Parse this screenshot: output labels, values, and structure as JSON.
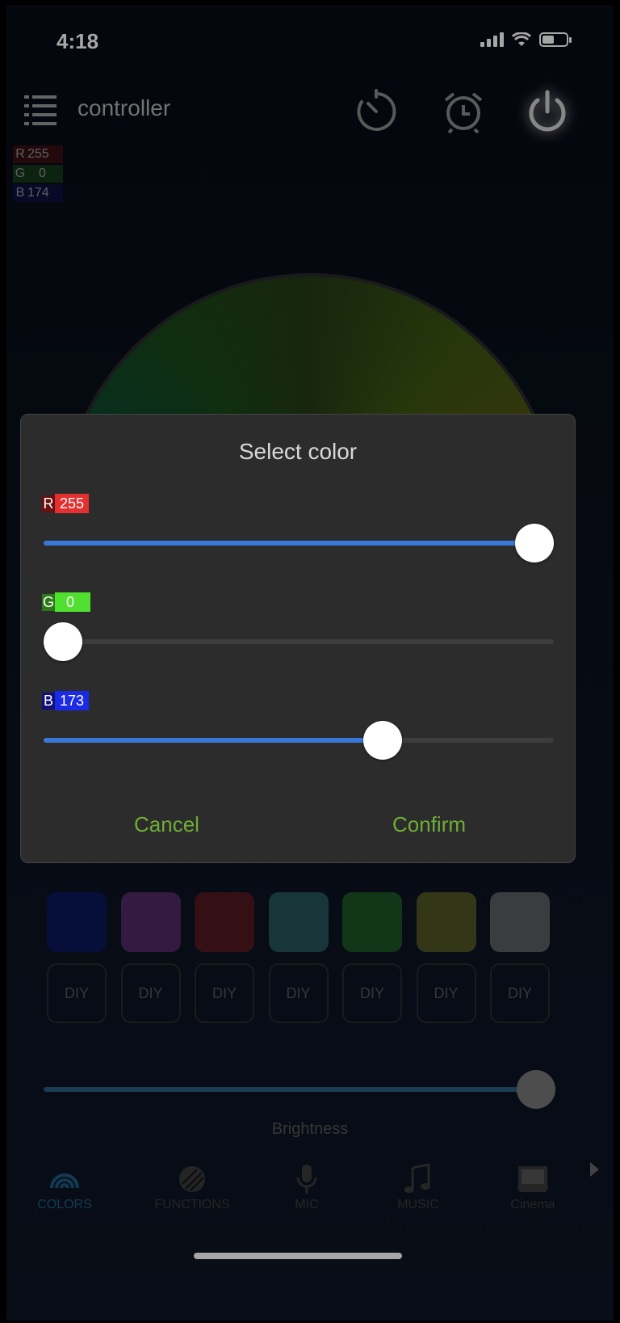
{
  "status_bar": {
    "time": "4:18"
  },
  "header": {
    "title": "controller"
  },
  "rgb_readout": {
    "r": "255",
    "g": "0",
    "b": "174"
  },
  "swatches": [
    {
      "color": "#0b1a8a"
    },
    {
      "color": "#8a3a9a"
    },
    {
      "color": "#8a1f1f"
    },
    {
      "color": "#3a8a8a"
    },
    {
      "color": "#2a8a2a"
    },
    {
      "color": "#8a8a2a"
    },
    {
      "color": "#9a9a9a"
    }
  ],
  "diy_slots": [
    "DIY",
    "DIY",
    "DIY",
    "DIY",
    "DIY",
    "DIY",
    "DIY"
  ],
  "brightness": {
    "label": "Brightness",
    "level": 1.0
  },
  "tabs": [
    {
      "label": "COLORS",
      "icon": "rainbow-icon",
      "active": true
    },
    {
      "label": "FUNCTIONS",
      "icon": "functions-icon"
    },
    {
      "label": "MIC",
      "icon": "mic-icon"
    },
    {
      "label": "MUSIC",
      "icon": "music-note-icon"
    },
    {
      "label": "Cinema",
      "icon": "cinema-icon"
    }
  ],
  "dialog": {
    "title": "Select color",
    "channels": {
      "r": {
        "letter": "R",
        "value": "255",
        "level": 1.0,
        "color": "#e53030"
      },
      "g": {
        "letter": "G",
        "value": "0",
        "level": 0.0,
        "color": "#4fe030"
      },
      "b": {
        "letter": "B",
        "value": "173",
        "level": 0.678,
        "color": "#1a2ae6"
      }
    },
    "cancel_label": "Cancel",
    "confirm_label": "Confirm"
  },
  "colors": {
    "accent_green": "#6fae36",
    "slider_blue": "#3a78d8"
  }
}
